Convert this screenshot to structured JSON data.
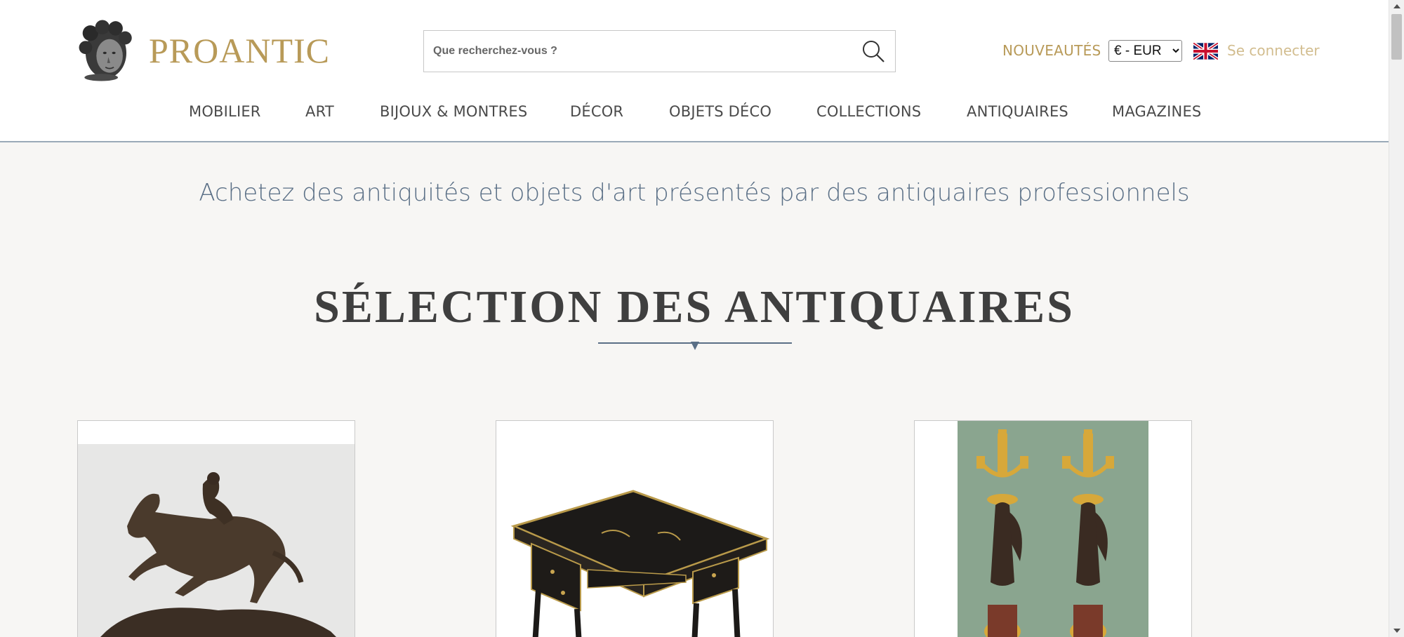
{
  "brand": {
    "name": "PROANTIC",
    "color": "#b89a58"
  },
  "search": {
    "placeholder": "Que recherchez-vous ?"
  },
  "header": {
    "nouveautes": "NOUVEAUTÉS",
    "currency": {
      "selected": "€ - EUR",
      "options": [
        "€ - EUR"
      ]
    },
    "language_flag": "uk-flag-icon",
    "login": "Se connecter"
  },
  "nav": {
    "items": [
      {
        "label": "MOBILIER"
      },
      {
        "label": "ART"
      },
      {
        "label": "BIJOUX & MONTRES"
      },
      {
        "label": "DÉCOR"
      },
      {
        "label": "OBJETS DÉCO"
      },
      {
        "label": "COLLECTIONS"
      },
      {
        "label": "ANTIQUAIRES"
      },
      {
        "label": "MAGAZINES"
      }
    ]
  },
  "tagline": "Achetez des antiquités et objets d'art présentés par des antiquaires professionnels",
  "section": {
    "title": "SÉLECTION DES ANTIQUAIRES"
  },
  "colors": {
    "accent_blue": "#5a6f86",
    "page_background": "#f7f6f4"
  }
}
